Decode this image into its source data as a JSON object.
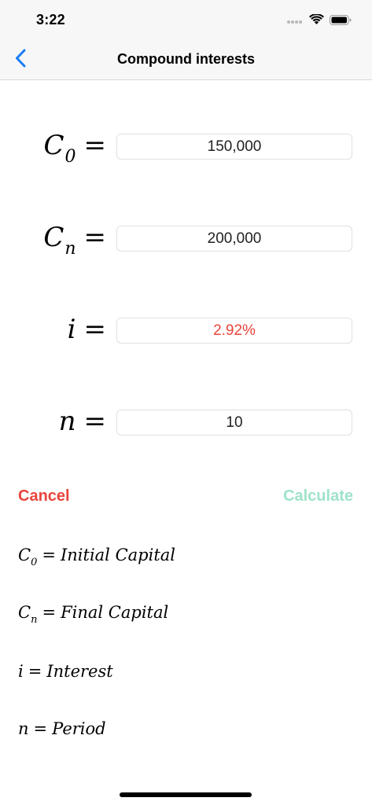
{
  "status_bar": {
    "time": "3:22"
  },
  "nav": {
    "title": "Compound interests",
    "back_icon": "chevron-left-icon"
  },
  "form": {
    "c0": {
      "symbol": "C",
      "subscript": "0",
      "equals": "=",
      "value": "150,000"
    },
    "cn": {
      "symbol": "C",
      "subscript": "n",
      "equals": "=",
      "value": "200,000"
    },
    "i": {
      "symbol": "i",
      "equals": "=",
      "value": "2.92%"
    },
    "n": {
      "symbol": "n",
      "equals": "=",
      "value": "10"
    }
  },
  "actions": {
    "cancel_label": "Cancel",
    "calculate_label": "Calculate"
  },
  "legend": {
    "c0": {
      "symbol": "C",
      "subscript": "0",
      "equals": "=",
      "text": "Initial Capital"
    },
    "cn": {
      "symbol": "C",
      "subscript": "n",
      "equals": "=",
      "text": "Final Capital"
    },
    "i": {
      "symbol": "i",
      "equals": "=",
      "text": "Interest"
    },
    "n": {
      "symbol": "n",
      "equals": "=",
      "text": "Period"
    }
  },
  "colors": {
    "accent_blue": "#1a7cf5",
    "cancel_red": "#e8453c",
    "calculate_green": "#9fe3c9",
    "result_red": "#e8453c"
  }
}
